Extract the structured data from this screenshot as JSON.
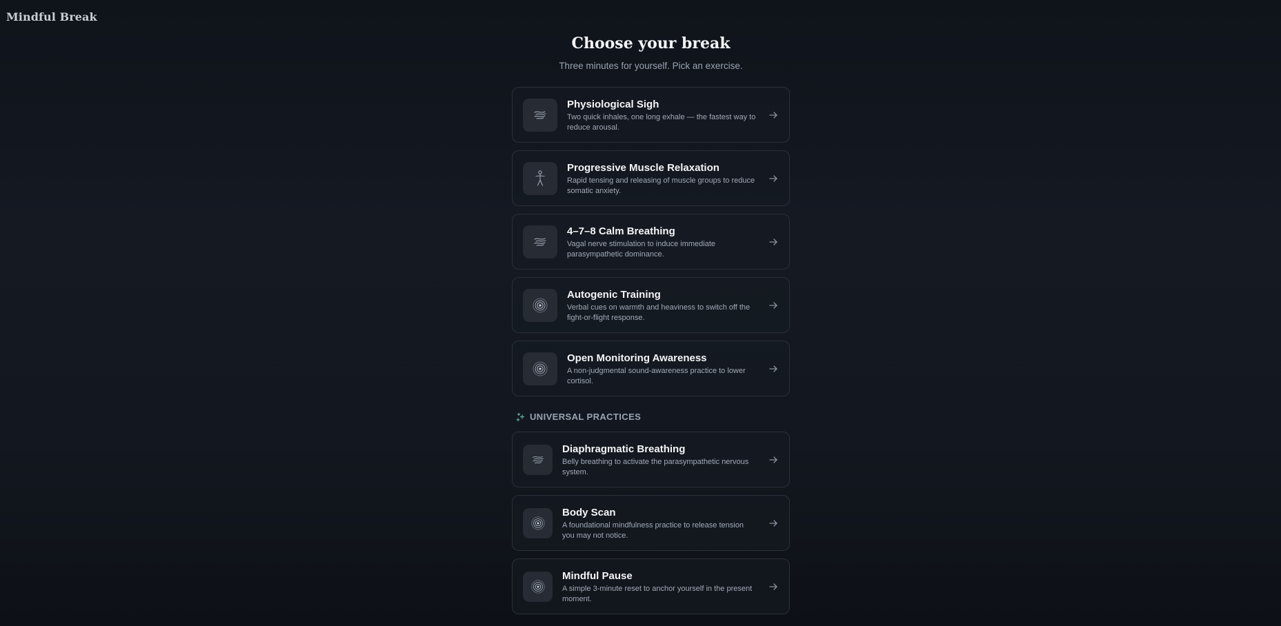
{
  "app": {
    "title": "Mindful Break"
  },
  "header": {
    "title": "Choose your break",
    "subtitle": "Three minutes for yourself. Pick an exercise."
  },
  "exercises": [
    {
      "title": "Physiological Sigh",
      "description": "Two quick inhales, one long exhale — the fastest way to reduce arousal.",
      "icon": "wind-icon"
    },
    {
      "title": "Progressive Muscle Relaxation",
      "description": "Rapid tensing and releasing of muscle groups to reduce somatic anxiety.",
      "icon": "person-icon"
    },
    {
      "title": "4–7–8 Calm Breathing",
      "description": "Vagal nerve stimulation to induce immediate parasympathetic dominance.",
      "icon": "wind-icon"
    },
    {
      "title": "Autogenic Training",
      "description": "Verbal cues on warmth and heaviness to switch off the fight-or-flight response.",
      "icon": "target-icon"
    },
    {
      "title": "Open Monitoring Awareness",
      "description": "A non-judgmental sound-awareness practice to lower cortisol.",
      "icon": "target-icon"
    }
  ],
  "universal": {
    "label": "UNIVERSAL PRACTICES",
    "icon": "sparkle-icon",
    "items": [
      {
        "title": "Diaphragmatic Breathing",
        "description": "Belly breathing to activate the parasympathetic nervous system.",
        "icon": "wind-icon"
      },
      {
        "title": "Body Scan",
        "description": "A foundational mindfulness practice to release tension you may not notice.",
        "icon": "target-icon"
      },
      {
        "title": "Mindful Pause",
        "description": "A simple 3-minute reset to anchor yourself in the present moment.",
        "icon": "target-icon"
      }
    ]
  },
  "colors": {
    "background": "#141922",
    "card_border": "#2a303a",
    "icon_tile": "#262b34",
    "accent_teal": "#5fb3a8"
  }
}
